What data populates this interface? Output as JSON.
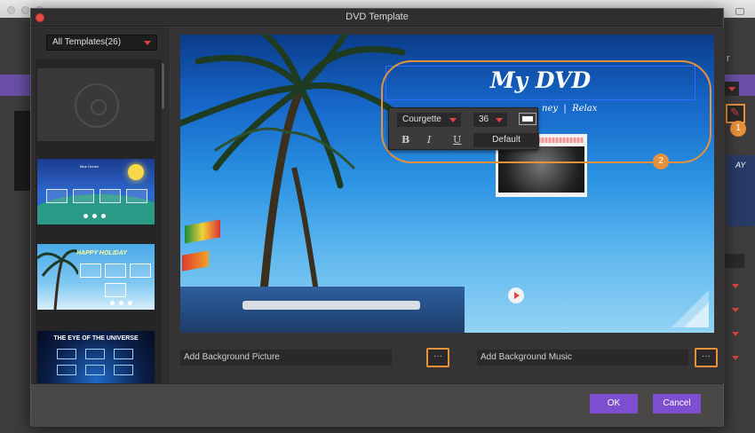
{
  "dialog": {
    "title": "DVD Template"
  },
  "templates": {
    "selector_label": "All Templates(26)",
    "items": [
      {
        "name": "Blank disc"
      },
      {
        "name": "Blue Dream",
        "text": "Blue Dream"
      },
      {
        "name": "Happy Holiday",
        "text": "HAPPY HOLIDAY"
      },
      {
        "name": "The Eye of the Universe",
        "text": "THE EYE OF THE UNIVERSE"
      }
    ]
  },
  "preview": {
    "menu_title": "My DVD",
    "subtitle": "ney  |  Relax"
  },
  "font_toolbar": {
    "font": "Courgette",
    "size": "36",
    "bold": "B",
    "italic": "I",
    "underline": "U",
    "default_label": "Default"
  },
  "badges": {
    "one": "1",
    "two": "2"
  },
  "background": {
    "picture_label": "Add Background Picture",
    "music_label": "Add Background Music",
    "browse_label": "···"
  },
  "footer": {
    "ok_label": "OK",
    "cancel_label": "Cancel"
  },
  "app_bg": {
    "right_letter": "r",
    "right_thumb_text": "AY"
  },
  "colors": {
    "accent_orange": "#e8913a",
    "button_purple": "#7b4fd0",
    "dropdown_red": "#e04343",
    "selection_blue": "#2f6bff"
  }
}
